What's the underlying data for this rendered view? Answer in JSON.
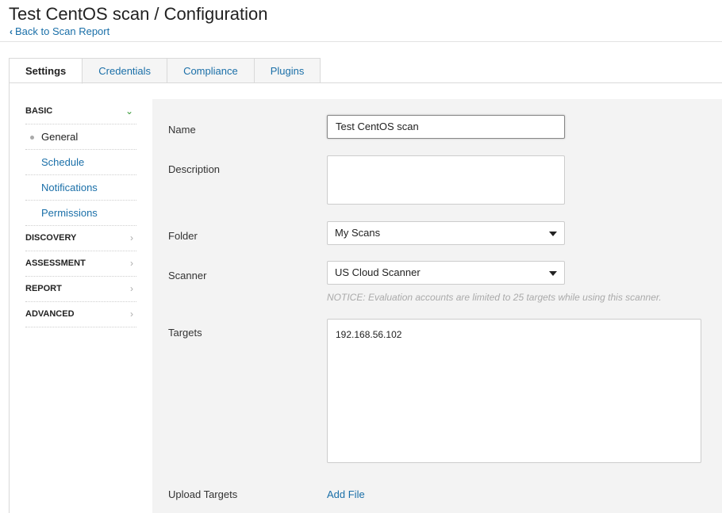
{
  "header": {
    "title": "Test CentOS scan / Configuration",
    "back_link": "Back to Scan Report"
  },
  "tabs": [
    {
      "label": "Settings",
      "active": true
    },
    {
      "label": "Credentials",
      "active": false
    },
    {
      "label": "Compliance",
      "active": false
    },
    {
      "label": "Plugins",
      "active": false
    }
  ],
  "sidebar": {
    "basic": {
      "label": "BASIC",
      "items": [
        "General",
        "Schedule",
        "Notifications",
        "Permissions"
      ]
    },
    "sections": [
      "DISCOVERY",
      "ASSESSMENT",
      "REPORT",
      "ADVANCED"
    ]
  },
  "form": {
    "name_label": "Name",
    "name_value": "Test CentOS scan",
    "description_label": "Description",
    "description_value": "",
    "folder_label": "Folder",
    "folder_value": "My Scans",
    "scanner_label": "Scanner",
    "scanner_value": "US Cloud Scanner",
    "scanner_notice": "NOTICE: Evaluation accounts are limited to 25 targets while using this scanner.",
    "targets_label": "Targets",
    "targets_value": "192.168.56.102",
    "upload_label": "Upload Targets",
    "add_file": "Add File"
  },
  "colors": {
    "link": "#1a6fa8",
    "panel_bg": "#f3f3f3",
    "open_caret": "#3a9b3a"
  }
}
